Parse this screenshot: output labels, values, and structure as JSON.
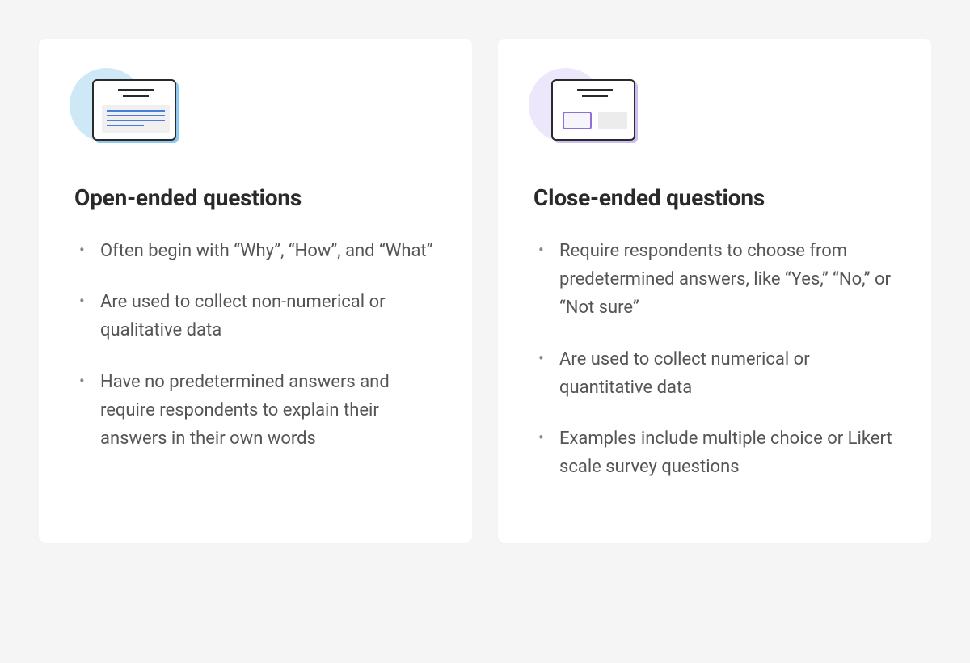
{
  "cards": [
    {
      "title": "Open-ended questions",
      "bullets": [
        "Often begin with “Why”, “How”, and “What”",
        "Are used to collect non-numerical or qualitative data",
        "Have no predetermined answers and require respondents to explain their answers in their own words"
      ]
    },
    {
      "title": "Close-ended questions",
      "bullets": [
        "Require respondents to choose from predetermined answers, like “Yes,” “No,” or “Not sure”",
        "Are used to collect numerical or quantitative data",
        "Examples include multiple choice or Likert scale survey questions"
      ]
    }
  ]
}
